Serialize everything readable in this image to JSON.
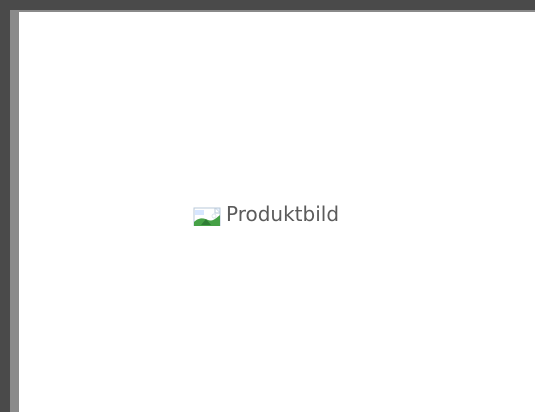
{
  "product_image": {
    "alt_text": "Produktbild",
    "icon": "broken-image-icon"
  },
  "colors": {
    "outer_background": "#4a4a4a",
    "frame_border": "#8a8a8a",
    "panel_background": "#ffffff",
    "alt_text": "#5b5b5b"
  }
}
